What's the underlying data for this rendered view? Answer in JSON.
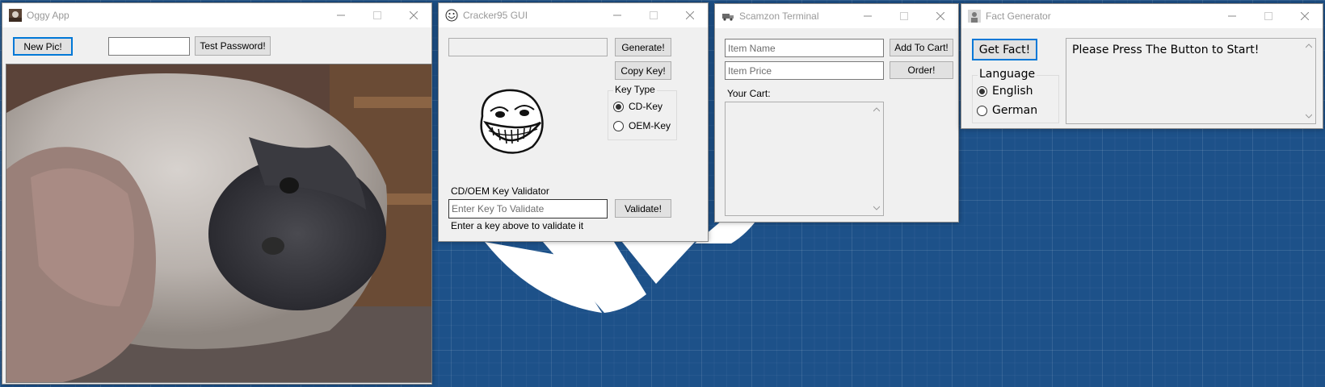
{
  "colors": {
    "desktop_bg": "#1d5189",
    "window_bg": "#f0f0f0",
    "titlebar_bg": "#ffffff",
    "accent": "#0078d7",
    "title_text": "#999999"
  },
  "oggy": {
    "title": "Oggy App",
    "new_pic_label": "New Pic!",
    "password_value": "",
    "test_password_label": "Test Password!"
  },
  "cracker": {
    "title": "Cracker95 GUI",
    "key_output_value": "",
    "generate_label": "Generate!",
    "copy_key_label": "Copy Key!",
    "key_type_label": "Key Type",
    "key_types": [
      {
        "label": "CD-Key",
        "selected": true
      },
      {
        "label": "OEM-Key",
        "selected": false
      }
    ],
    "validator_label": "CD/OEM Key Validator",
    "validate_placeholder": "Enter Key To Validate",
    "validate_label": "Validate!",
    "status_text": "Enter a key above to validate it"
  },
  "scamzon": {
    "title": "Scamzon Terminal",
    "item_name_placeholder": "Item Name",
    "item_price_placeholder": "Item Price",
    "add_to_cart_label": "Add To Cart!",
    "order_label": "Order!",
    "cart_label": "Your Cart:"
  },
  "fact": {
    "title": "Fact Generator",
    "get_fact_label": "Get Fact!",
    "language_label": "Language",
    "languages": [
      {
        "label": "English",
        "selected": true
      },
      {
        "label": "German",
        "selected": false
      }
    ],
    "output_text": "Please Press The Button to Start!"
  }
}
